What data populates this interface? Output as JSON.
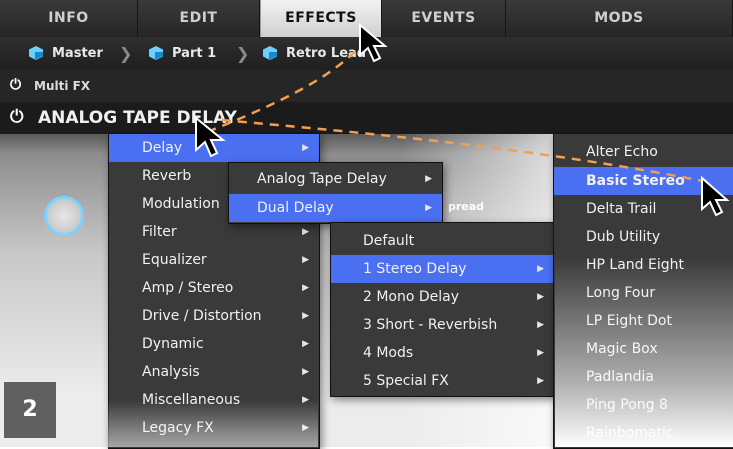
{
  "tabs": [
    {
      "label": "INFO",
      "active": false
    },
    {
      "label": "EDIT",
      "active": false
    },
    {
      "label": "EFFECTS",
      "active": true
    },
    {
      "label": "EVENTS",
      "active": false
    },
    {
      "label": "MODS",
      "active": false
    }
  ],
  "breadcrumb": [
    "Master",
    "Part 1",
    "Retro Lead"
  ],
  "multi_fx_label": "Multi FX",
  "effect_title": "ANALOG TAPE DELAY",
  "partial_labels": {
    "spread": "pread"
  },
  "menu_categories": [
    {
      "label": "Delay",
      "selected": true,
      "submenu": true
    },
    {
      "label": "Reverb",
      "selected": false,
      "submenu": false
    },
    {
      "label": "Modulation",
      "selected": false,
      "submenu": false
    },
    {
      "label": "Filter",
      "selected": false,
      "submenu": true
    },
    {
      "label": "Equalizer",
      "selected": false,
      "submenu": true
    },
    {
      "label": "Amp / Stereo",
      "selected": false,
      "submenu": true
    },
    {
      "label": "Drive / Distortion",
      "selected": false,
      "submenu": true
    },
    {
      "label": "Dynamic",
      "selected": false,
      "submenu": true
    },
    {
      "label": "Analysis",
      "selected": false,
      "submenu": true
    },
    {
      "label": "Miscellaneous",
      "selected": false,
      "submenu": true
    },
    {
      "label": "Legacy FX",
      "selected": false,
      "submenu": true
    }
  ],
  "menu_delay_types": [
    {
      "label": "Analog Tape Delay",
      "selected": false,
      "submenu": true
    },
    {
      "label": "Dual Delay",
      "selected": true,
      "submenu": true
    }
  ],
  "menu_dual_delay": [
    {
      "label": "Default",
      "selected": false,
      "submenu": false
    },
    {
      "label": "1 Stereo Delay",
      "selected": true,
      "submenu": true
    },
    {
      "label": "2 Mono Delay",
      "selected": false,
      "submenu": true
    },
    {
      "label": "3 Short - Reverbish",
      "selected": false,
      "submenu": true
    },
    {
      "label": "4 Mods",
      "selected": false,
      "submenu": true
    },
    {
      "label": "5 Special FX",
      "selected": false,
      "submenu": true
    }
  ],
  "menu_presets": [
    {
      "label": "Alter Echo",
      "selected": false
    },
    {
      "label": "Basic Stereo",
      "selected": true
    },
    {
      "label": "Delta Trail",
      "selected": false
    },
    {
      "label": "Dub Utility",
      "selected": false
    },
    {
      "label": "HP Land Eight",
      "selected": false
    },
    {
      "label": "Long Four",
      "selected": false
    },
    {
      "label": "LP Eight Dot",
      "selected": false
    },
    {
      "label": "Magic Box",
      "selected": false
    },
    {
      "label": "Padlandia",
      "selected": false
    },
    {
      "label": "Ping Pong 8",
      "selected": false
    },
    {
      "label": "Rainbomatic",
      "selected": false
    }
  ],
  "step_badge": "2",
  "colors": {
    "selection": "#4a6ff0",
    "menu_bg": "#3a3a3a",
    "annotation_line": "#f0a050",
    "knob_ring": "#7fd2ff"
  }
}
